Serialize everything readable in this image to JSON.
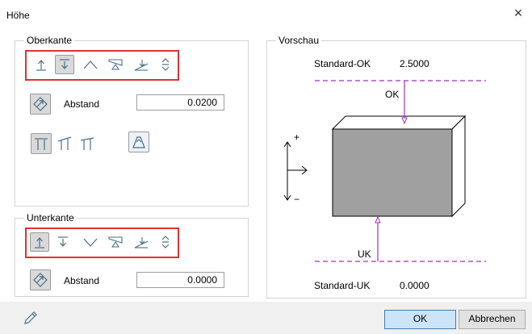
{
  "dialog": {
    "title": "Höhe",
    "close_symbol": "×"
  },
  "oberkante": {
    "legend": "Oberkante",
    "abstand_label": "Abstand",
    "abstand_value": "0.0200"
  },
  "unterkante": {
    "legend": "Unterkante",
    "abstand_label": "Abstand",
    "abstand_value": "0.0000"
  },
  "vorschau": {
    "legend": "Vorschau",
    "standard_ok_label": "Standard-OK",
    "standard_ok_value": "2.5000",
    "ok_marker": "OK",
    "uk_marker": "UK",
    "plus": "+",
    "minus": "−",
    "standard_uk_label": "Standard-UK",
    "standard_uk_value": "0.0000"
  },
  "footer": {
    "ok_label": "OK",
    "cancel_label": "Abbrechen"
  },
  "colors": {
    "accent_red": "#e03131",
    "preview_line": "#9b30c8",
    "block_fill": "#a0a0a0"
  }
}
